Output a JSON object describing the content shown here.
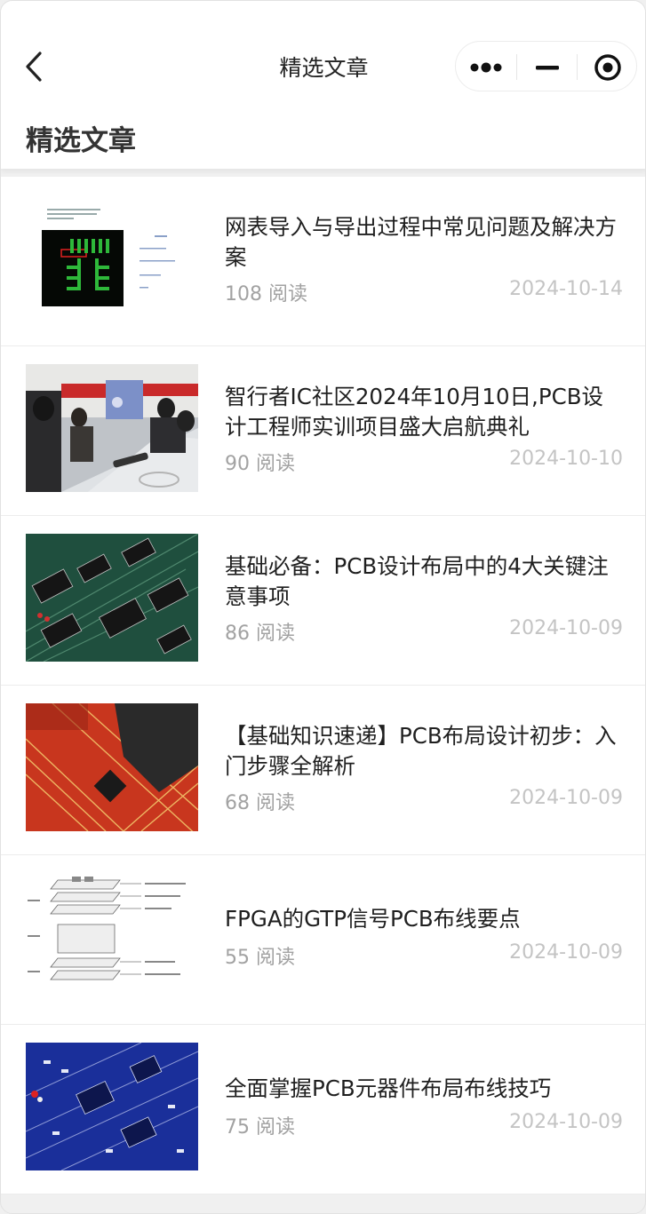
{
  "navbar": {
    "title": "精选文章",
    "back_icon": "chevron-left-icon",
    "capsule": {
      "more_icon": "more-dots-icon",
      "minimize_icon": "minimize-icon",
      "close_icon": "target-close-icon"
    }
  },
  "section": {
    "title": "精选文章"
  },
  "articles": [
    {
      "title": "网表导入与导出过程中常见问题及解决方案",
      "reads": "108 阅读",
      "date": "2024-10-14",
      "thumb": "cadence-netlist-screenshot"
    },
    {
      "title": "智行者IC社区2024年10月10日,PCB设计工程师实训项目盛大启航典礼",
      "reads": "90 阅读",
      "date": "2024-10-10",
      "thumb": "classroom-photo"
    },
    {
      "title": "基础必备：PCB设计布局中的4大关键注意事项",
      "reads": "86 阅读",
      "date": "2024-10-09",
      "thumb": "green-pcb-photo"
    },
    {
      "title": "【基础知识速递】PCB布局设计初步：入门步骤全解析",
      "reads": "68 阅读",
      "date": "2024-10-09",
      "thumb": "red-pcb-photo"
    },
    {
      "title": "FPGA的GTP信号PCB布线要点",
      "reads": "55 阅读",
      "date": "2024-10-09",
      "thumb": "layer-stackup-diagram"
    },
    {
      "title": "全面掌握PCB元器件布局布线技巧",
      "reads": "75 阅读",
      "date": "2024-10-09",
      "thumb": "blue-pcb-photo"
    }
  ],
  "colors": {
    "background": "#f0f0f0",
    "card": "#ffffff",
    "meta_text": "#a2a2a2",
    "date_text": "#c4c4c4"
  }
}
